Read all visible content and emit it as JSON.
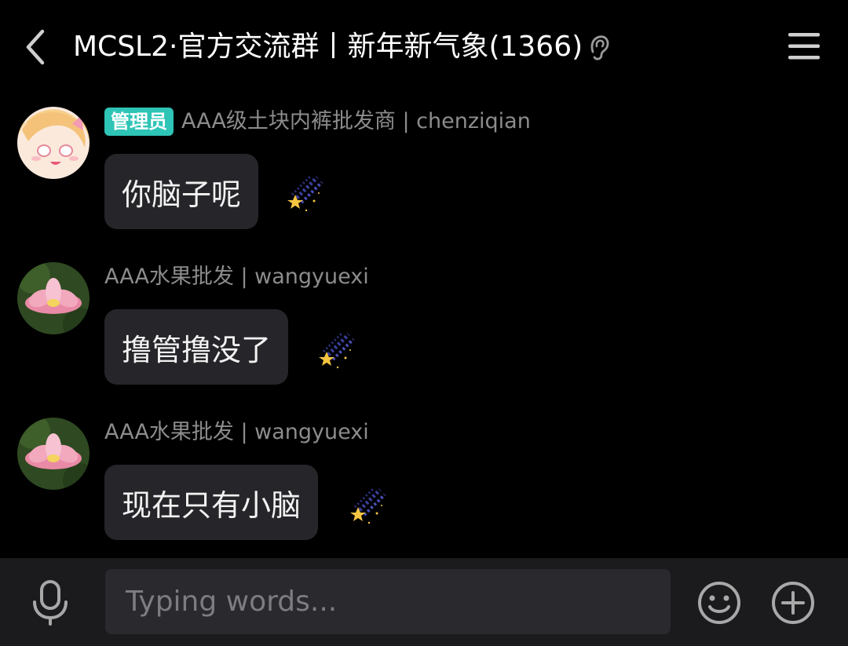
{
  "header": {
    "title": "MCSL2·官方交流群丨新年新气象(1366)",
    "back_icon": "chevron-left-icon",
    "ear_icon": "ear-icon",
    "menu_icon": "hamburger-menu-icon"
  },
  "messages": [
    {
      "badge": "管理员",
      "sender": "AAA级土块内裤批发商 | chenziqian",
      "text": "你脑子呢",
      "avatar_icon": "anime-girl-avatar",
      "sticker_icon": "shooting-star-sticker"
    },
    {
      "badge": "",
      "sender": "AAA水果批发 | wangyuexi",
      "text": "撸管撸没了",
      "avatar_icon": "lotus-flower-avatar",
      "sticker_icon": "shooting-star-sticker"
    },
    {
      "badge": "",
      "sender": "AAA水果批发 | wangyuexi",
      "text": "现在只有小脑",
      "avatar_icon": "lotus-flower-avatar",
      "sticker_icon": "shooting-star-sticker"
    }
  ],
  "input": {
    "placeholder": "Typing words...",
    "value": "",
    "mic_icon": "microphone-icon",
    "emoji_icon": "smiley-icon",
    "plus_icon": "plus-circle-icon"
  },
  "colors": {
    "background": "#000000",
    "bubble": "#262529",
    "admin_badge": "#2ec4b6",
    "sender_name": "#8c8c8c",
    "input_bar": "#1b1b1e"
  }
}
